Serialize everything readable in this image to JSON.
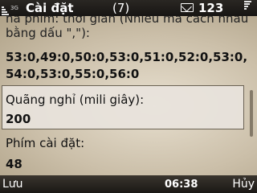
{
  "status_bar": {
    "network": "3G",
    "title": "Cài đặt",
    "tab_count": "(7)",
    "input_mode": "123",
    "icons": [
      "signal-strength-icon",
      "message-icon",
      "battery-icon"
    ]
  },
  "form": {
    "hint_text_partial": "hả phím: thời gian (Nhiều mà cách nhau",
    "hint_text_line2": "bằng dấu \",\"):",
    "sequence_line1": "53:0,49:0,50:0,53:0,51:0,52:0,53:0,",
    "sequence_line2": "54:0,53:0,55:0,56:0",
    "pause_label": "Quãng nghỉ (mili giây):",
    "pause_value": "200",
    "key_setting_label": "Phím cài đặt:",
    "key_setting_value": "48"
  },
  "softkeys": {
    "left": "Lưu",
    "clock": "06:38",
    "right": "Hủy"
  }
}
